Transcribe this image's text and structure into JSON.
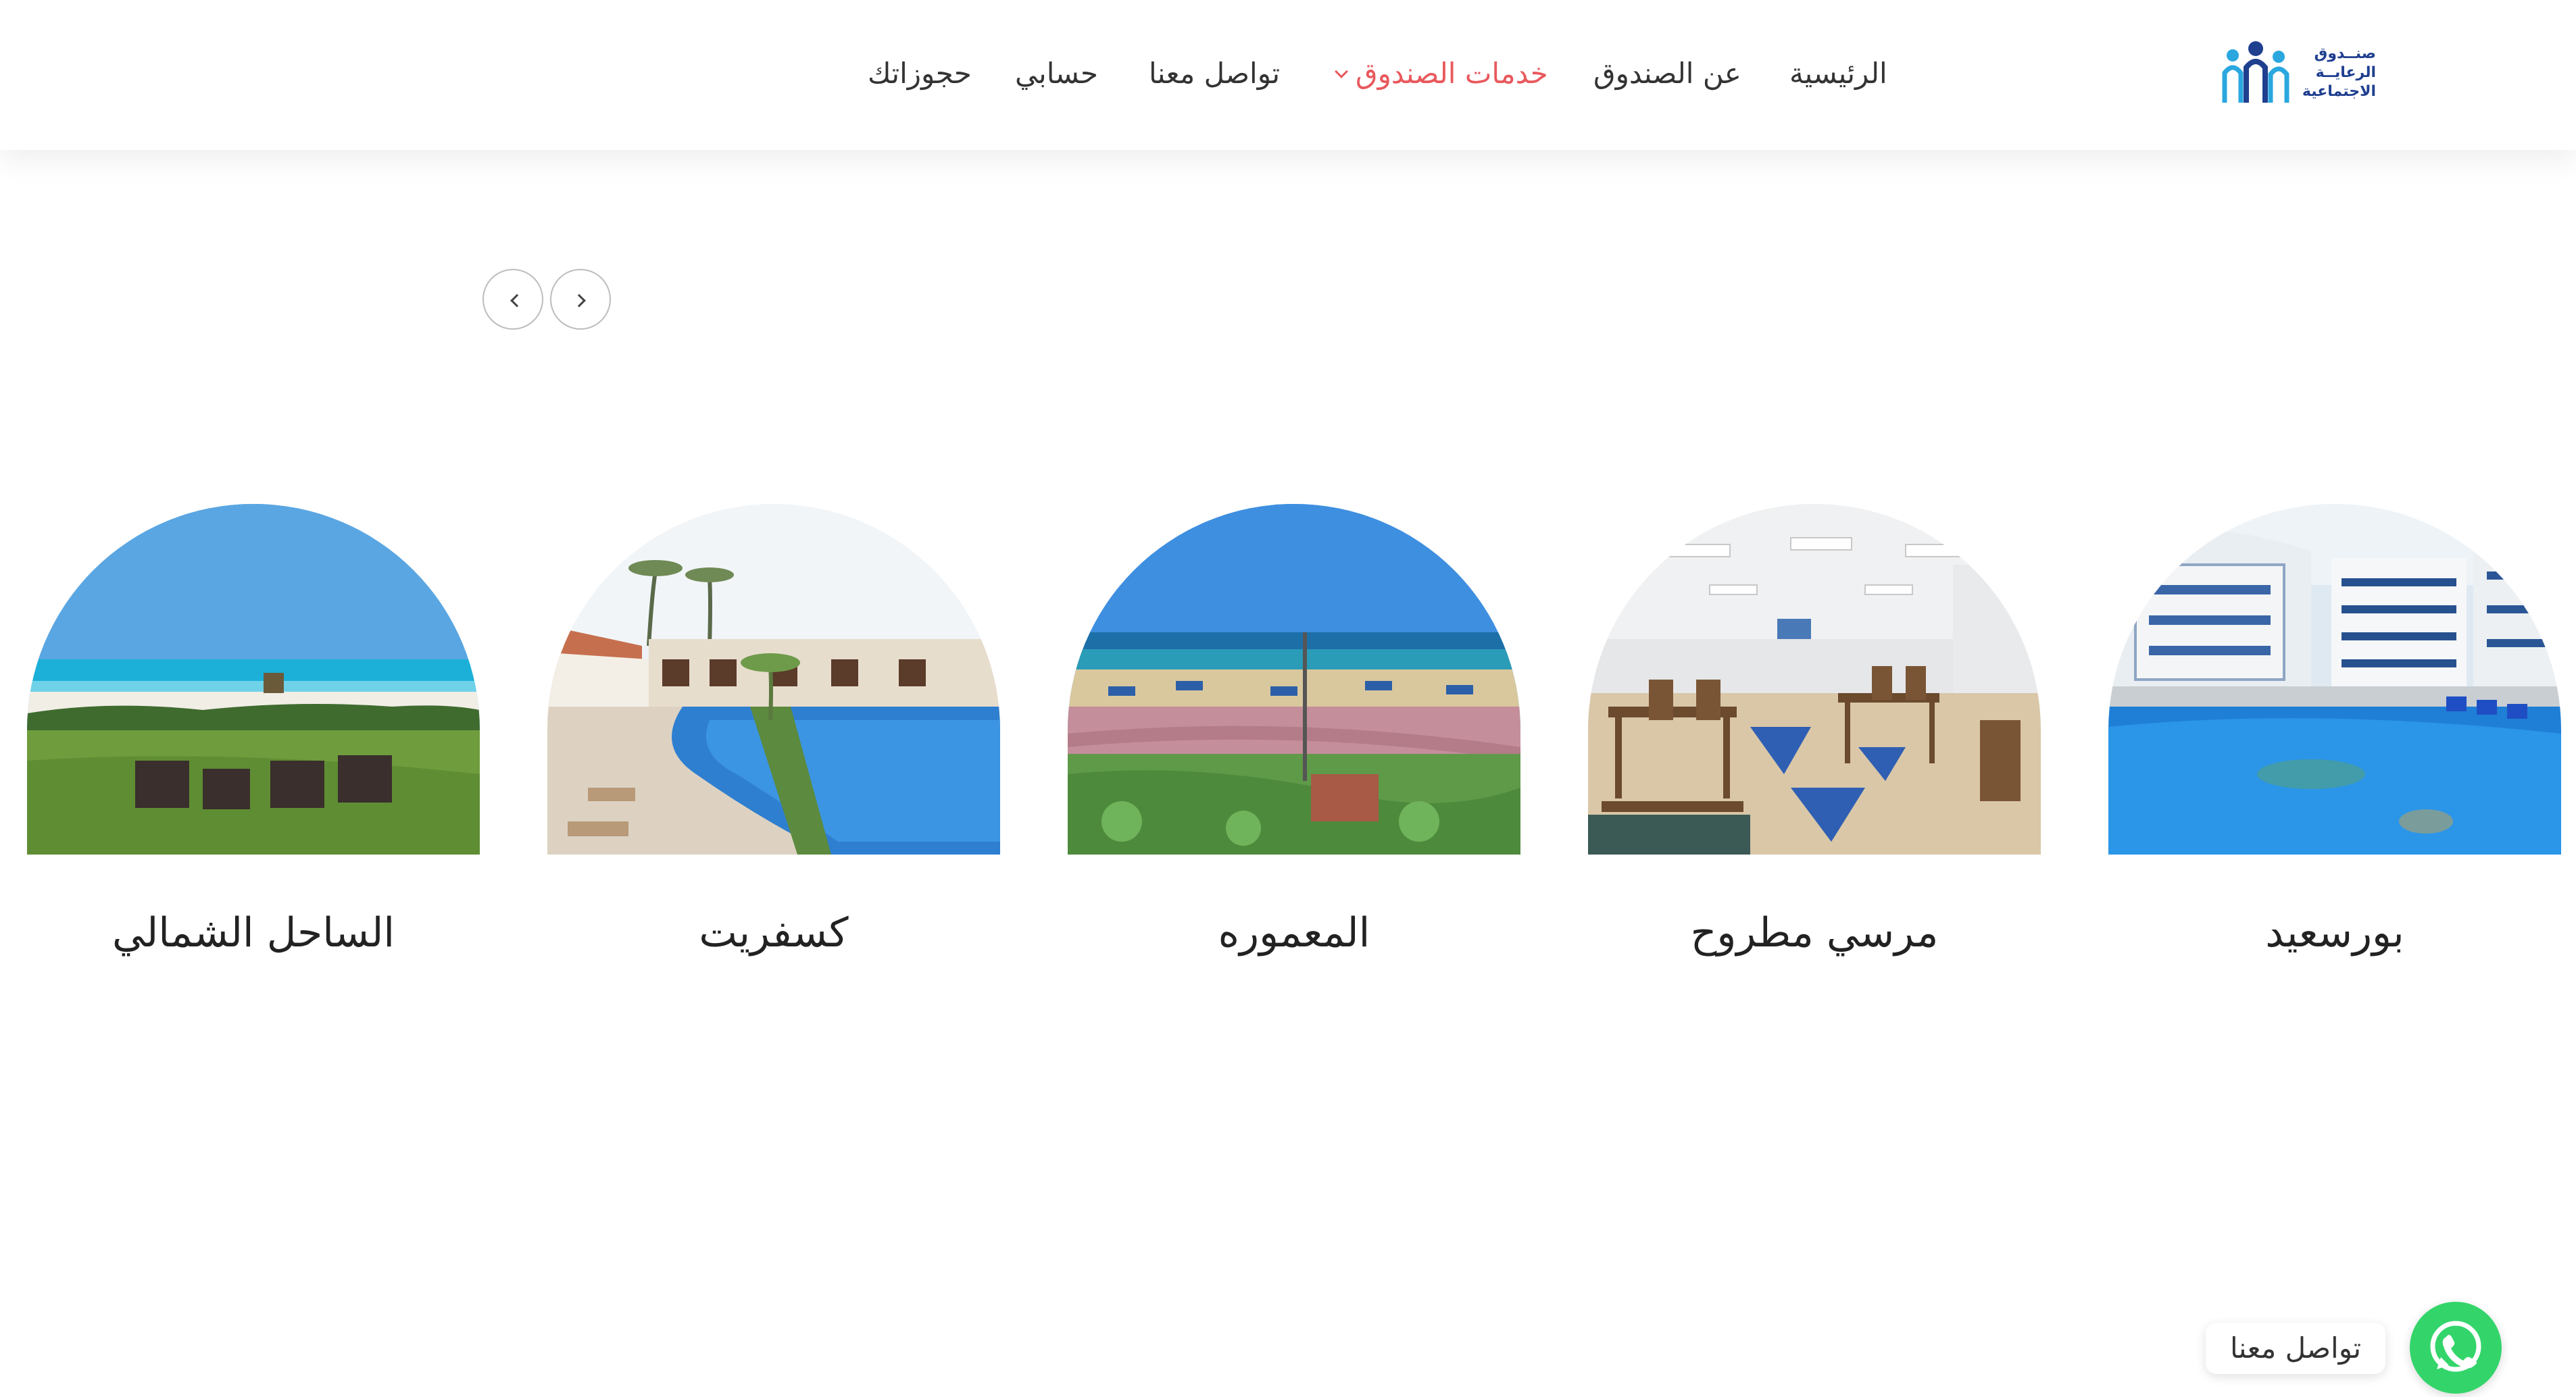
{
  "header": {
    "logo": {
      "lines": [
        "صنــدوق",
        "الرعايــة",
        "الاجتماعية"
      ],
      "accent_color": "#1f3f8f",
      "secondary_color": "#2aa7df"
    },
    "nav": [
      {
        "label": "الرئيسية",
        "active": false
      },
      {
        "label": "عن الصندوق",
        "active": false
      },
      {
        "label": "خدمات الصندوق",
        "active": true,
        "has_dropdown": true
      },
      {
        "label": "تواصل معنا",
        "active": false
      },
      {
        "label": "حسابي",
        "active": false
      },
      {
        "label": "حجوزاتك",
        "active": false
      }
    ],
    "active_color": "#e8585c"
  },
  "slider": {
    "prev_icon": "chevron-left-icon",
    "next_icon": "chevron-right-icon"
  },
  "destinations": [
    {
      "name": "بورسعيد",
      "image": "pool-resort-photo"
    },
    {
      "name": "مرسي مطروح",
      "image": "dining-hall-photo"
    },
    {
      "name": "المعموره",
      "image": "beach-promenade-photo"
    },
    {
      "name": "كسفريت",
      "image": "lagoon-pool-resort-photo"
    },
    {
      "name": "الساحل الشمالي",
      "image": "beach-lawn-photo"
    }
  ],
  "chat": {
    "label": "تواصل معنا",
    "icon": "whatsapp-icon",
    "color": "#33d56a"
  }
}
